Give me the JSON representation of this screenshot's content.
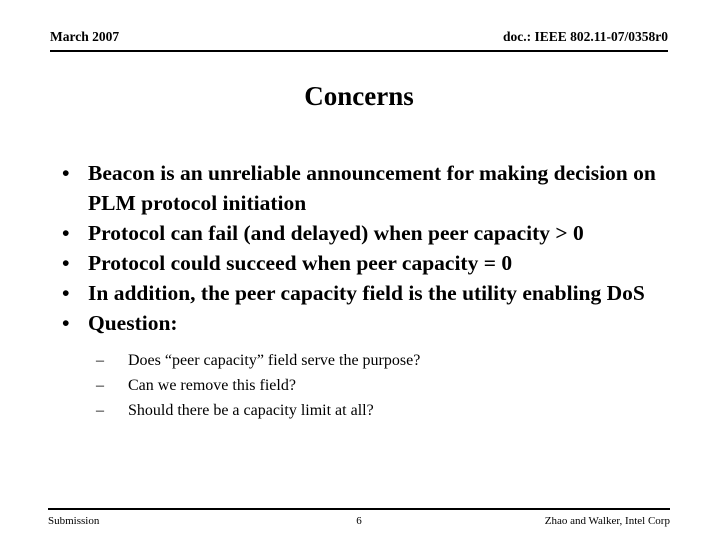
{
  "slide": {
    "header": {
      "left": "March 2007",
      "right": "doc.: IEEE 802.11-07/0358r0"
    },
    "title": "Concerns",
    "bullets": [
      {
        "marker": "•",
        "text": "Beacon is an unreliable announcement for making decision on PLM protocol initiation"
      },
      {
        "marker": "•",
        "text": "Protocol can fail (and delayed) when peer capacity > 0"
      },
      {
        "marker": "•",
        "text": "Protocol could succeed when peer capacity = 0"
      },
      {
        "marker": "•",
        "text": "In addition, the peer capacity field is the utility enabling DoS"
      },
      {
        "marker": "•",
        "text": "Question:"
      }
    ],
    "sub_bullets": [
      {
        "marker": "–",
        "text": "Does “peer capacity” field serve the purpose?"
      },
      {
        "marker": "–",
        "text": "Can we remove this field?"
      },
      {
        "marker": "–",
        "text": "Should there be a capacity limit at all?"
      }
    ],
    "footer": {
      "left": "Submission",
      "center": "6",
      "right": "Zhao and Walker, Intel Corp"
    },
    "colors": {
      "text": "#000000",
      "background": "#ffffff",
      "rule": "#000000"
    }
  }
}
